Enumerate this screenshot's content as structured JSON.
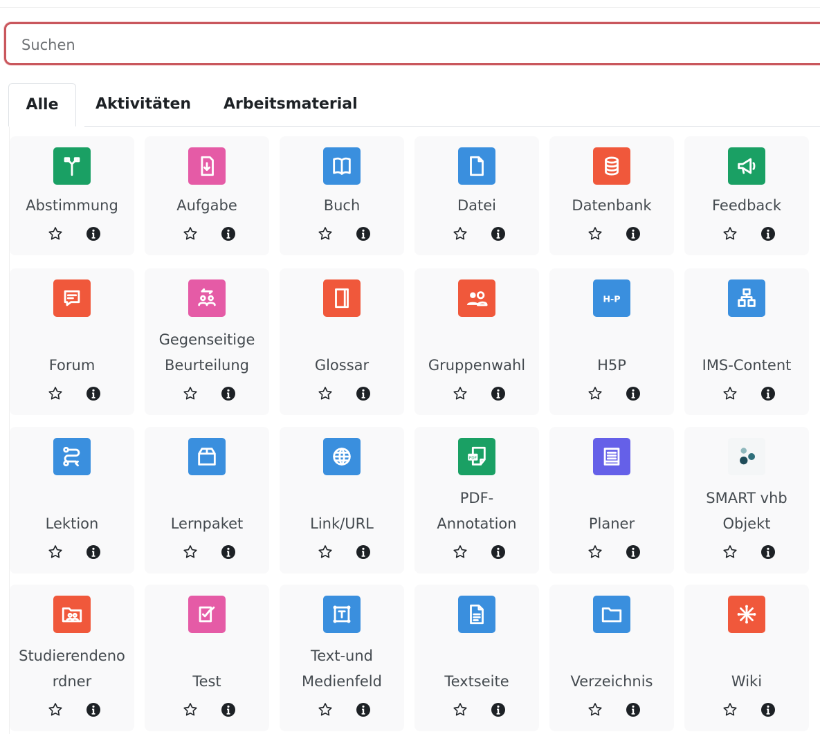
{
  "search": {
    "placeholder": "Suchen",
    "value": ""
  },
  "tabs": [
    {
      "label": "Alle",
      "active": true
    },
    {
      "label": "Aktivitäten",
      "active": false
    },
    {
      "label": "Arbeitsmaterial",
      "active": false
    }
  ],
  "items": [
    {
      "label": "Abstimmung",
      "icon": "choice-icon",
      "color": "#1aa064"
    },
    {
      "label": "Aufgabe",
      "icon": "assignment-icon",
      "color": "#e55ba6"
    },
    {
      "label": "Buch",
      "icon": "book-icon",
      "color": "#3a8fde"
    },
    {
      "label": "Datei",
      "icon": "file-icon",
      "color": "#3a8fde"
    },
    {
      "label": "Datenbank",
      "icon": "database-icon",
      "color": "#f0583b"
    },
    {
      "label": "Feedback",
      "icon": "megaphone-icon",
      "color": "#1aa064"
    },
    {
      "label": "Forum",
      "icon": "forum-icon",
      "color": "#f0583b"
    },
    {
      "label": "Gegenseitige Beurteilung",
      "icon": "workshop-icon",
      "color": "#e55ba6"
    },
    {
      "label": "Glossar",
      "icon": "glossary-icon",
      "color": "#f0583b"
    },
    {
      "label": "Gruppenwahl",
      "icon": "group-icon",
      "color": "#f0583b"
    },
    {
      "label": "H5P",
      "icon": "h5p-icon",
      "color": "#3a8fde"
    },
    {
      "label": "IMS-Content",
      "icon": "ims-content-icon",
      "color": "#3a8fde"
    },
    {
      "label": "Lektion",
      "icon": "lesson-icon",
      "color": "#3a8fde"
    },
    {
      "label": "Lernpaket",
      "icon": "package-icon",
      "color": "#3a8fde"
    },
    {
      "label": "Link/URL",
      "icon": "globe-icon",
      "color": "#3a8fde"
    },
    {
      "label": "PDF-Annotation",
      "icon": "pdf-annotation-icon",
      "color": "#1aa064"
    },
    {
      "label": "Planer",
      "icon": "planner-icon",
      "color": "#6560e8"
    },
    {
      "label": "SMART vhb Objekt",
      "icon": "smart-vhb-icon",
      "color": "#f4f6f7"
    },
    {
      "label": "Studierendenordner",
      "icon": "student-folder-icon",
      "color": "#f0583b"
    },
    {
      "label": "Test",
      "icon": "quiz-icon",
      "color": "#e55ba6"
    },
    {
      "label": "Text-und Medienfeld",
      "icon": "text-media-icon",
      "color": "#3a8fde"
    },
    {
      "label": "Textseite",
      "icon": "page-icon",
      "color": "#3a8fde"
    },
    {
      "label": "Verzeichnis",
      "icon": "folder-icon",
      "color": "#3a8fde"
    },
    {
      "label": "Wiki",
      "icon": "wiki-icon",
      "color": "#f0583b"
    }
  ]
}
